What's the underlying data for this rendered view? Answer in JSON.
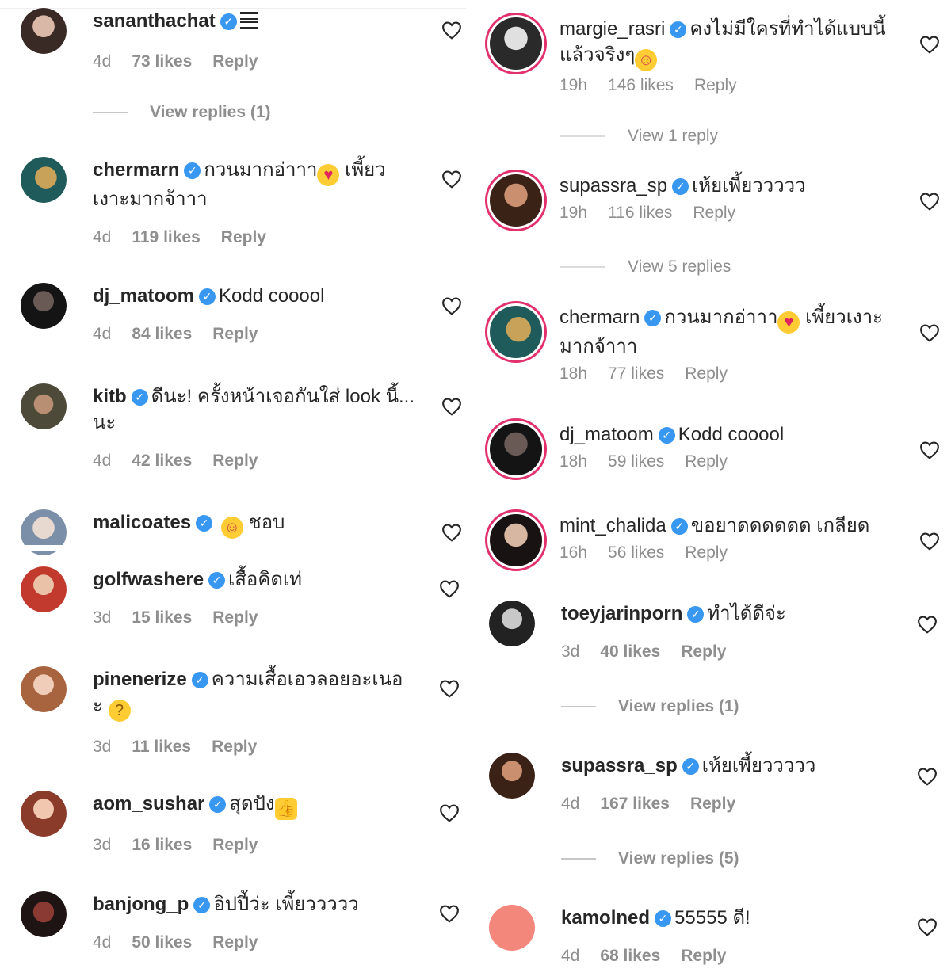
{
  "left": {
    "comments": [
      {
        "username": "sananthachat",
        "text": "",
        "time": "4d",
        "likes": "73 likes",
        "reply": "Reply",
        "view_replies": "View replies (1)"
      },
      {
        "username": "chermarn",
        "text": "กวนมากอ่าาา",
        "text2": "เพี้ยว",
        "text3": "เงาะมากจ้าาา",
        "time": "4d",
        "likes": "119 likes",
        "reply": "Reply"
      },
      {
        "username": "dj_matoom",
        "text": "Kodd cooool",
        "time": "4d",
        "likes": "84 likes",
        "reply": "Reply"
      },
      {
        "username": "kitb",
        "text": "ดีนะ! ครั้งหน้าเจอกันใส่ look นี้...",
        "text2": "นะ",
        "time": "4d",
        "likes": "42 likes",
        "reply": "Reply"
      },
      {
        "username": "malicoates",
        "text": "ชอบ"
      },
      {
        "username": "golfwashere",
        "text": "เสื้อคิดเท่",
        "time": "3d",
        "likes": "15 likes",
        "reply": "Reply"
      },
      {
        "username": "pinenerize",
        "text": "ความเสื้อเอวลอยอะเนอ",
        "text2": "ะ",
        "time": "3d",
        "likes": "11 likes",
        "reply": "Reply"
      },
      {
        "username": "aom_sushar",
        "text": "สุดปัง",
        "time": "3d",
        "likes": "16 likes",
        "reply": "Reply"
      },
      {
        "username": "banjong_p",
        "text": "อิปปี้ว่ะ เพี้ยววววว",
        "time": "4d",
        "likes": "50 likes",
        "reply": "Reply"
      }
    ]
  },
  "right": {
    "comments": [
      {
        "username": "margie_rasri",
        "text": "คงไม่มีใครที่ทำได้แบบนี้",
        "text2": "แล้วจริงๆ",
        "time": "19h",
        "likes": "146 likes",
        "reply": "Reply",
        "view_replies": "View 1 reply"
      },
      {
        "username": "supassra_sp",
        "text": "เห้ยเพี้ยววววว",
        "time": "19h",
        "likes": "116 likes",
        "reply": "Reply",
        "view_replies": "View 5 replies"
      },
      {
        "username": "chermarn",
        "text": "กวนมากอ่าาา",
        "text2": "เพี้ยวเงาะ",
        "text3": "มากจ้าาา",
        "time": "18h",
        "likes": "77 likes",
        "reply": "Reply"
      },
      {
        "username": "dj_matoom",
        "text": "Kodd cooool",
        "time": "18h",
        "likes": "59 likes",
        "reply": "Reply"
      },
      {
        "username": "mint_chalida",
        "text": "ขอยาดดดดดด เกลียด",
        "time": "16h",
        "likes": "56 likes",
        "reply": "Reply"
      },
      {
        "username": "toeyjarinporn",
        "text": "ทำได้ดีจ่ะ",
        "time": "3d",
        "likes": "40 likes",
        "reply": "Reply",
        "view_replies": "View replies (1)"
      },
      {
        "username": "supassra_sp",
        "text": "เห้ยเพี้ยววววว",
        "time": "4d",
        "likes": "167 likes",
        "reply": "Reply",
        "view_replies": "View replies (5)"
      },
      {
        "username": "kamolned",
        "text": "55555 ดี!",
        "time": "4d",
        "likes": "68 likes",
        "reply": "Reply"
      }
    ]
  },
  "icons": {
    "verified": "verified-badge-icon",
    "heart": "heart-outline-icon"
  },
  "colors": {
    "verified": "#3897f0",
    "ring": "#e1306c",
    "meta": "#8e8e8e",
    "text": "#262626"
  }
}
